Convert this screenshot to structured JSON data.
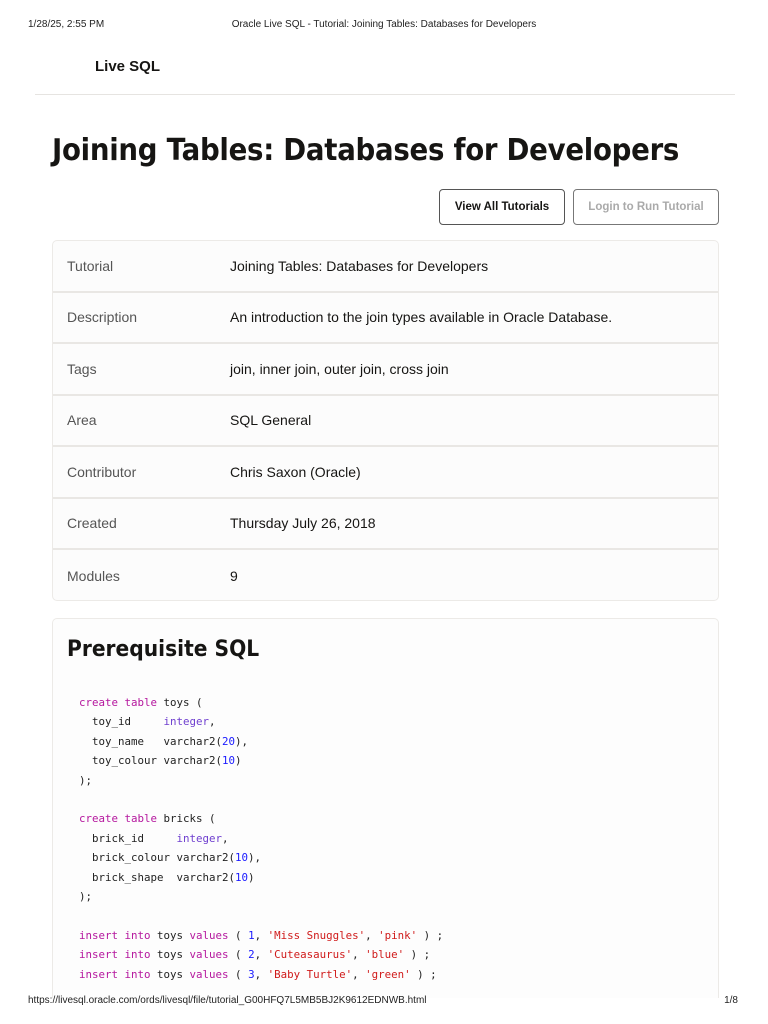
{
  "print_header": {
    "datetime": "1/28/25, 2:55 PM",
    "page_title": "Oracle Live SQL - Tutorial: Joining Tables: Databases for Developers"
  },
  "print_footer": {
    "url": "https://livesql.oracle.com/ords/livesql/file/tutorial_G00HFQ7L5MB5BJ2K9612EDNWB.html",
    "page": "1/8"
  },
  "header": {
    "brand": "Live SQL"
  },
  "title": "Joining Tables: Databases for Developers",
  "buttons": {
    "view_all": "View All Tutorials",
    "login": "Login to Run Tutorial"
  },
  "details": [
    {
      "key": "Tutorial",
      "value": "Joining Tables: Databases for Developers"
    },
    {
      "key": "Description",
      "value": "An introduction to the join types available in Oracle Database."
    },
    {
      "key": "Tags",
      "value": "join, inner join, outer join, cross join"
    },
    {
      "key": "Area",
      "value": "SQL General"
    },
    {
      "key": "Contributor",
      "value": "Chris Saxon (Oracle)"
    },
    {
      "key": "Created",
      "value": "Thursday July 26, 2018"
    },
    {
      "key": "Modules",
      "value": "9"
    }
  ],
  "prereq": {
    "title": "Prerequisite SQL",
    "code": [
      [
        [
          "kw",
          "create table"
        ],
        [
          "pl",
          " toys ("
        ]
      ],
      [
        [
          "pl",
          "  toy_id     "
        ],
        [
          "ty",
          "integer"
        ],
        [
          "pl",
          ","
        ]
      ],
      [
        [
          "pl",
          "  toy_name   varchar2("
        ],
        [
          "num",
          "20"
        ],
        [
          "pl",
          "),"
        ]
      ],
      [
        [
          "pl",
          "  toy_colour varchar2("
        ],
        [
          "num",
          "10"
        ],
        [
          "pl",
          ")"
        ]
      ],
      [
        [
          "pl",
          ");"
        ]
      ],
      [
        [
          "pl",
          " "
        ]
      ],
      [
        [
          "kw",
          "create table"
        ],
        [
          "pl",
          " bricks ("
        ]
      ],
      [
        [
          "pl",
          "  brick_id     "
        ],
        [
          "ty",
          "integer"
        ],
        [
          "pl",
          ","
        ]
      ],
      [
        [
          "pl",
          "  brick_colour varchar2("
        ],
        [
          "num",
          "10"
        ],
        [
          "pl",
          "),"
        ]
      ],
      [
        [
          "pl",
          "  brick_shape  varchar2("
        ],
        [
          "num",
          "10"
        ],
        [
          "pl",
          ")"
        ]
      ],
      [
        [
          "pl",
          ");"
        ]
      ],
      [
        [
          "pl",
          " "
        ]
      ],
      [
        [
          "kw",
          "insert into"
        ],
        [
          "pl",
          " toys "
        ],
        [
          "kw",
          "values"
        ],
        [
          "pl",
          " ( "
        ],
        [
          "num",
          "1"
        ],
        [
          "pl",
          ", "
        ],
        [
          "str",
          "'Miss Snuggles'"
        ],
        [
          "pl",
          ", "
        ],
        [
          "str",
          "'pink'"
        ],
        [
          "pl",
          " ) ;"
        ]
      ],
      [
        [
          "kw",
          "insert into"
        ],
        [
          "pl",
          " toys "
        ],
        [
          "kw",
          "values"
        ],
        [
          "pl",
          " ( "
        ],
        [
          "num",
          "2"
        ],
        [
          "pl",
          ", "
        ],
        [
          "str",
          "'Cuteasaurus'"
        ],
        [
          "pl",
          ", "
        ],
        [
          "str",
          "'blue'"
        ],
        [
          "pl",
          " ) ;"
        ]
      ],
      [
        [
          "kw",
          "insert into"
        ],
        [
          "pl",
          " toys "
        ],
        [
          "kw",
          "values"
        ],
        [
          "pl",
          " ( "
        ],
        [
          "num",
          "3"
        ],
        [
          "pl",
          ", "
        ],
        [
          "str",
          "'Baby Turtle'"
        ],
        [
          "pl",
          ", "
        ],
        [
          "str",
          "'green'"
        ],
        [
          "pl",
          " ) ;"
        ]
      ]
    ]
  }
}
